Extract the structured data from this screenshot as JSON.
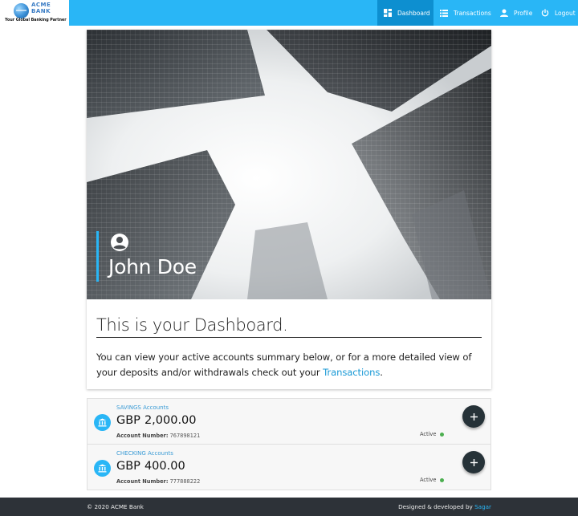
{
  "brand": {
    "name_line1": "ACME",
    "name_line2": "BANK",
    "tagline": "Your Global Banking Partner"
  },
  "nav": {
    "items": [
      {
        "label": "Dashboard",
        "icon": "dashboard-icon",
        "active": true
      },
      {
        "label": "Transactions",
        "icon": "list-icon",
        "active": false
      },
      {
        "label": "Profile",
        "icon": "person-icon",
        "active": false
      },
      {
        "label": "Logout",
        "icon": "power-icon",
        "active": false
      }
    ]
  },
  "hero": {
    "user_icon": "account-circle-icon",
    "user_name": "John Doe"
  },
  "dashboard": {
    "title": "This is your Dashboard.",
    "intro_text": "You can view your active accounts summary below, or for a more detailed view of your deposits and/or withdrawals check out your ",
    "link_text": "Transactions",
    "intro_end": "."
  },
  "accounts": [
    {
      "type_label": "SAVINGS Accounts",
      "currency": "GBP",
      "amount": "2,000.00",
      "number_label": "Account Number:",
      "number": "767898121",
      "status": "Active",
      "icon": "bank-icon"
    },
    {
      "type_label": "CHECKING Accounts",
      "currency": "GBP",
      "amount": "400.00",
      "number_label": "Account Number:",
      "number": "777888222",
      "status": "Active",
      "icon": "bank-icon"
    }
  ],
  "footer": {
    "copyright": "© 2020 ACME Bank",
    "credit_prefix": "Designed & developed by",
    "author": "Sagar"
  },
  "colors": {
    "primary": "#29b6f6",
    "active_nav": "#0d8fd0",
    "footer_bg": "#2d3238",
    "fab": "#263238",
    "status_active": "#4caf50"
  }
}
